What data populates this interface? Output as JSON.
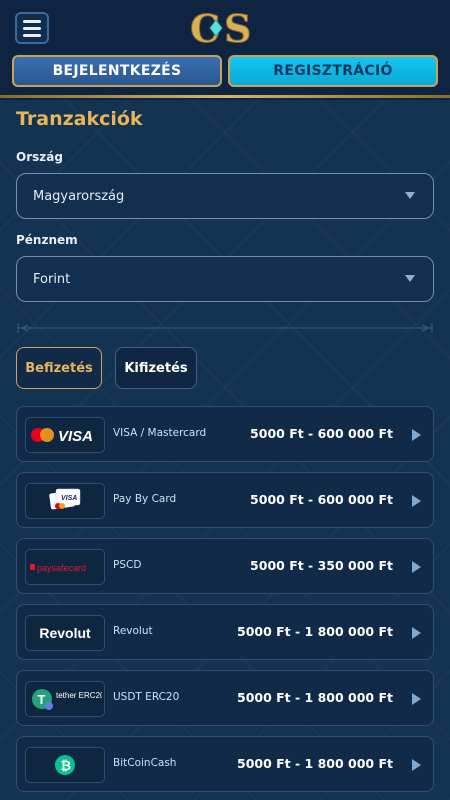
{
  "header": {
    "logo_text": "CS",
    "login_label": "BEJELENTKEZÉS",
    "register_label": "REGISZTRÁCIÓ"
  },
  "page": {
    "title": "Tranzakciók",
    "country_label": "Ország",
    "country_value": "Magyarország",
    "currency_label": "Pénznem",
    "currency_value": "Forint"
  },
  "tabs": {
    "deposit": "Befizetés",
    "withdraw": "Kifizetés"
  },
  "methods": [
    {
      "name": "VISA / Mastercard",
      "range": "5000 Ft - 600 000 Ft",
      "logo": "VISA"
    },
    {
      "name": "Pay By Card",
      "range": "5000 Ft - 600 000 Ft",
      "logo": "VISA"
    },
    {
      "name": "PSCD",
      "range": "5000 Ft - 350 000 Ft",
      "logo": "paysafecard"
    },
    {
      "name": "Revolut",
      "range": "5000 Ft - 1 800 000 Ft",
      "logo": "Revolut"
    },
    {
      "name": "USDT ERC20",
      "range": "5000 Ft - 1 800 000 Ft",
      "logo": "tether ERC20"
    },
    {
      "name": "BitCoinCash",
      "range": "5000 Ft - 1 800 000 Ft",
      "logo": ""
    }
  ],
  "colors": {
    "accent_gold": "#e8b55a",
    "register_cyan": "#13c7f0",
    "login_blue": "#3a6fb0"
  }
}
